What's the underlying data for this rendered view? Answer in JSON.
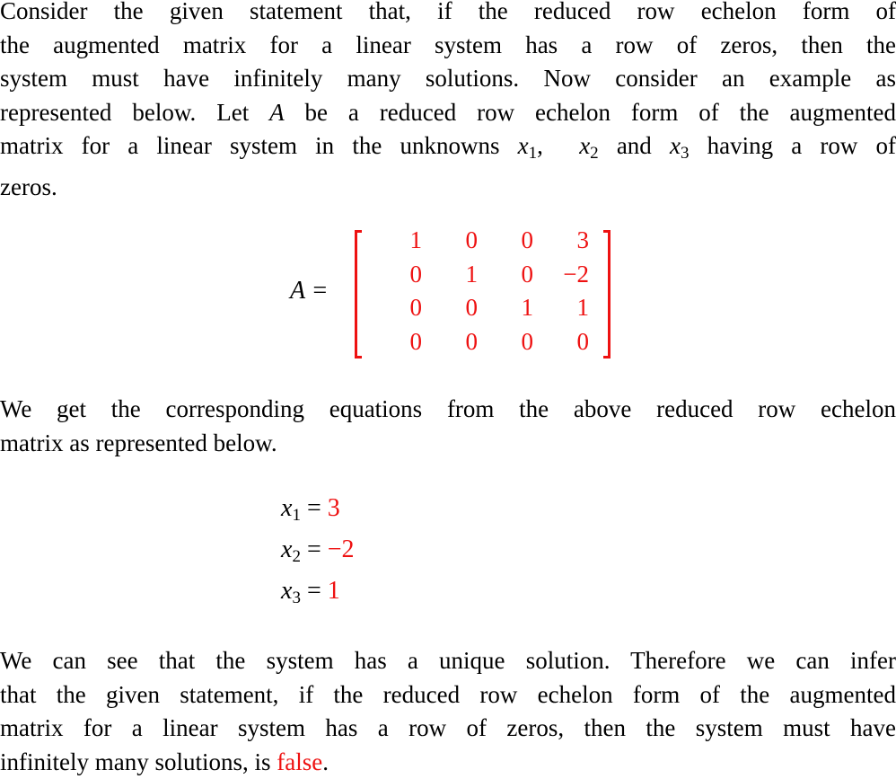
{
  "paragraph1": {
    "lines": [
      "Consider the given statement that, if the reduced row echelon form of",
      "the augmented matrix for a linear system has a row of zeros, then the",
      "system must have infinitely many solutions.  Now consider an example as",
      "represented below. Let",
      "be a reduced row echelon form of the augmented",
      "matrix for a linear system in the unknowns",
      "and",
      "having a row of",
      "zeros."
    ],
    "matrix_name": "A",
    "var": "x",
    "sub1": "1",
    "sub2": "2",
    "sub3": "3",
    "comma": ","
  },
  "matrix": {
    "label": "A =",
    "rows": [
      [
        "1",
        "0",
        "0",
        "3"
      ],
      [
        "0",
        "1",
        "0",
        "−2"
      ],
      [
        "0",
        "0",
        "1",
        "1"
      ],
      [
        "0",
        "0",
        "0",
        "0"
      ]
    ],
    "accent_color": "#ee1111"
  },
  "paragraph2": {
    "lines": [
      "We get the corresponding equations from the above reduced row echelon",
      "matrix as represented below."
    ]
  },
  "equations": [
    {
      "var": "x",
      "sub": "1",
      "eq": " = ",
      "value": "3"
    },
    {
      "var": "x",
      "sub": "2",
      "eq": " = ",
      "value": "−2"
    },
    {
      "var": "x",
      "sub": "3",
      "eq": " = ",
      "value": "1"
    }
  ],
  "paragraph3": {
    "lines": [
      "We can see that the system has a unique solution.  Therefore we can infer",
      "that the given statement, if the reduced row echelon form of the augmented",
      "matrix for a linear system has a row of zeros, then the system must have",
      "infinitely many solutions, is"
    ],
    "conclusion": "false",
    "period": "."
  }
}
